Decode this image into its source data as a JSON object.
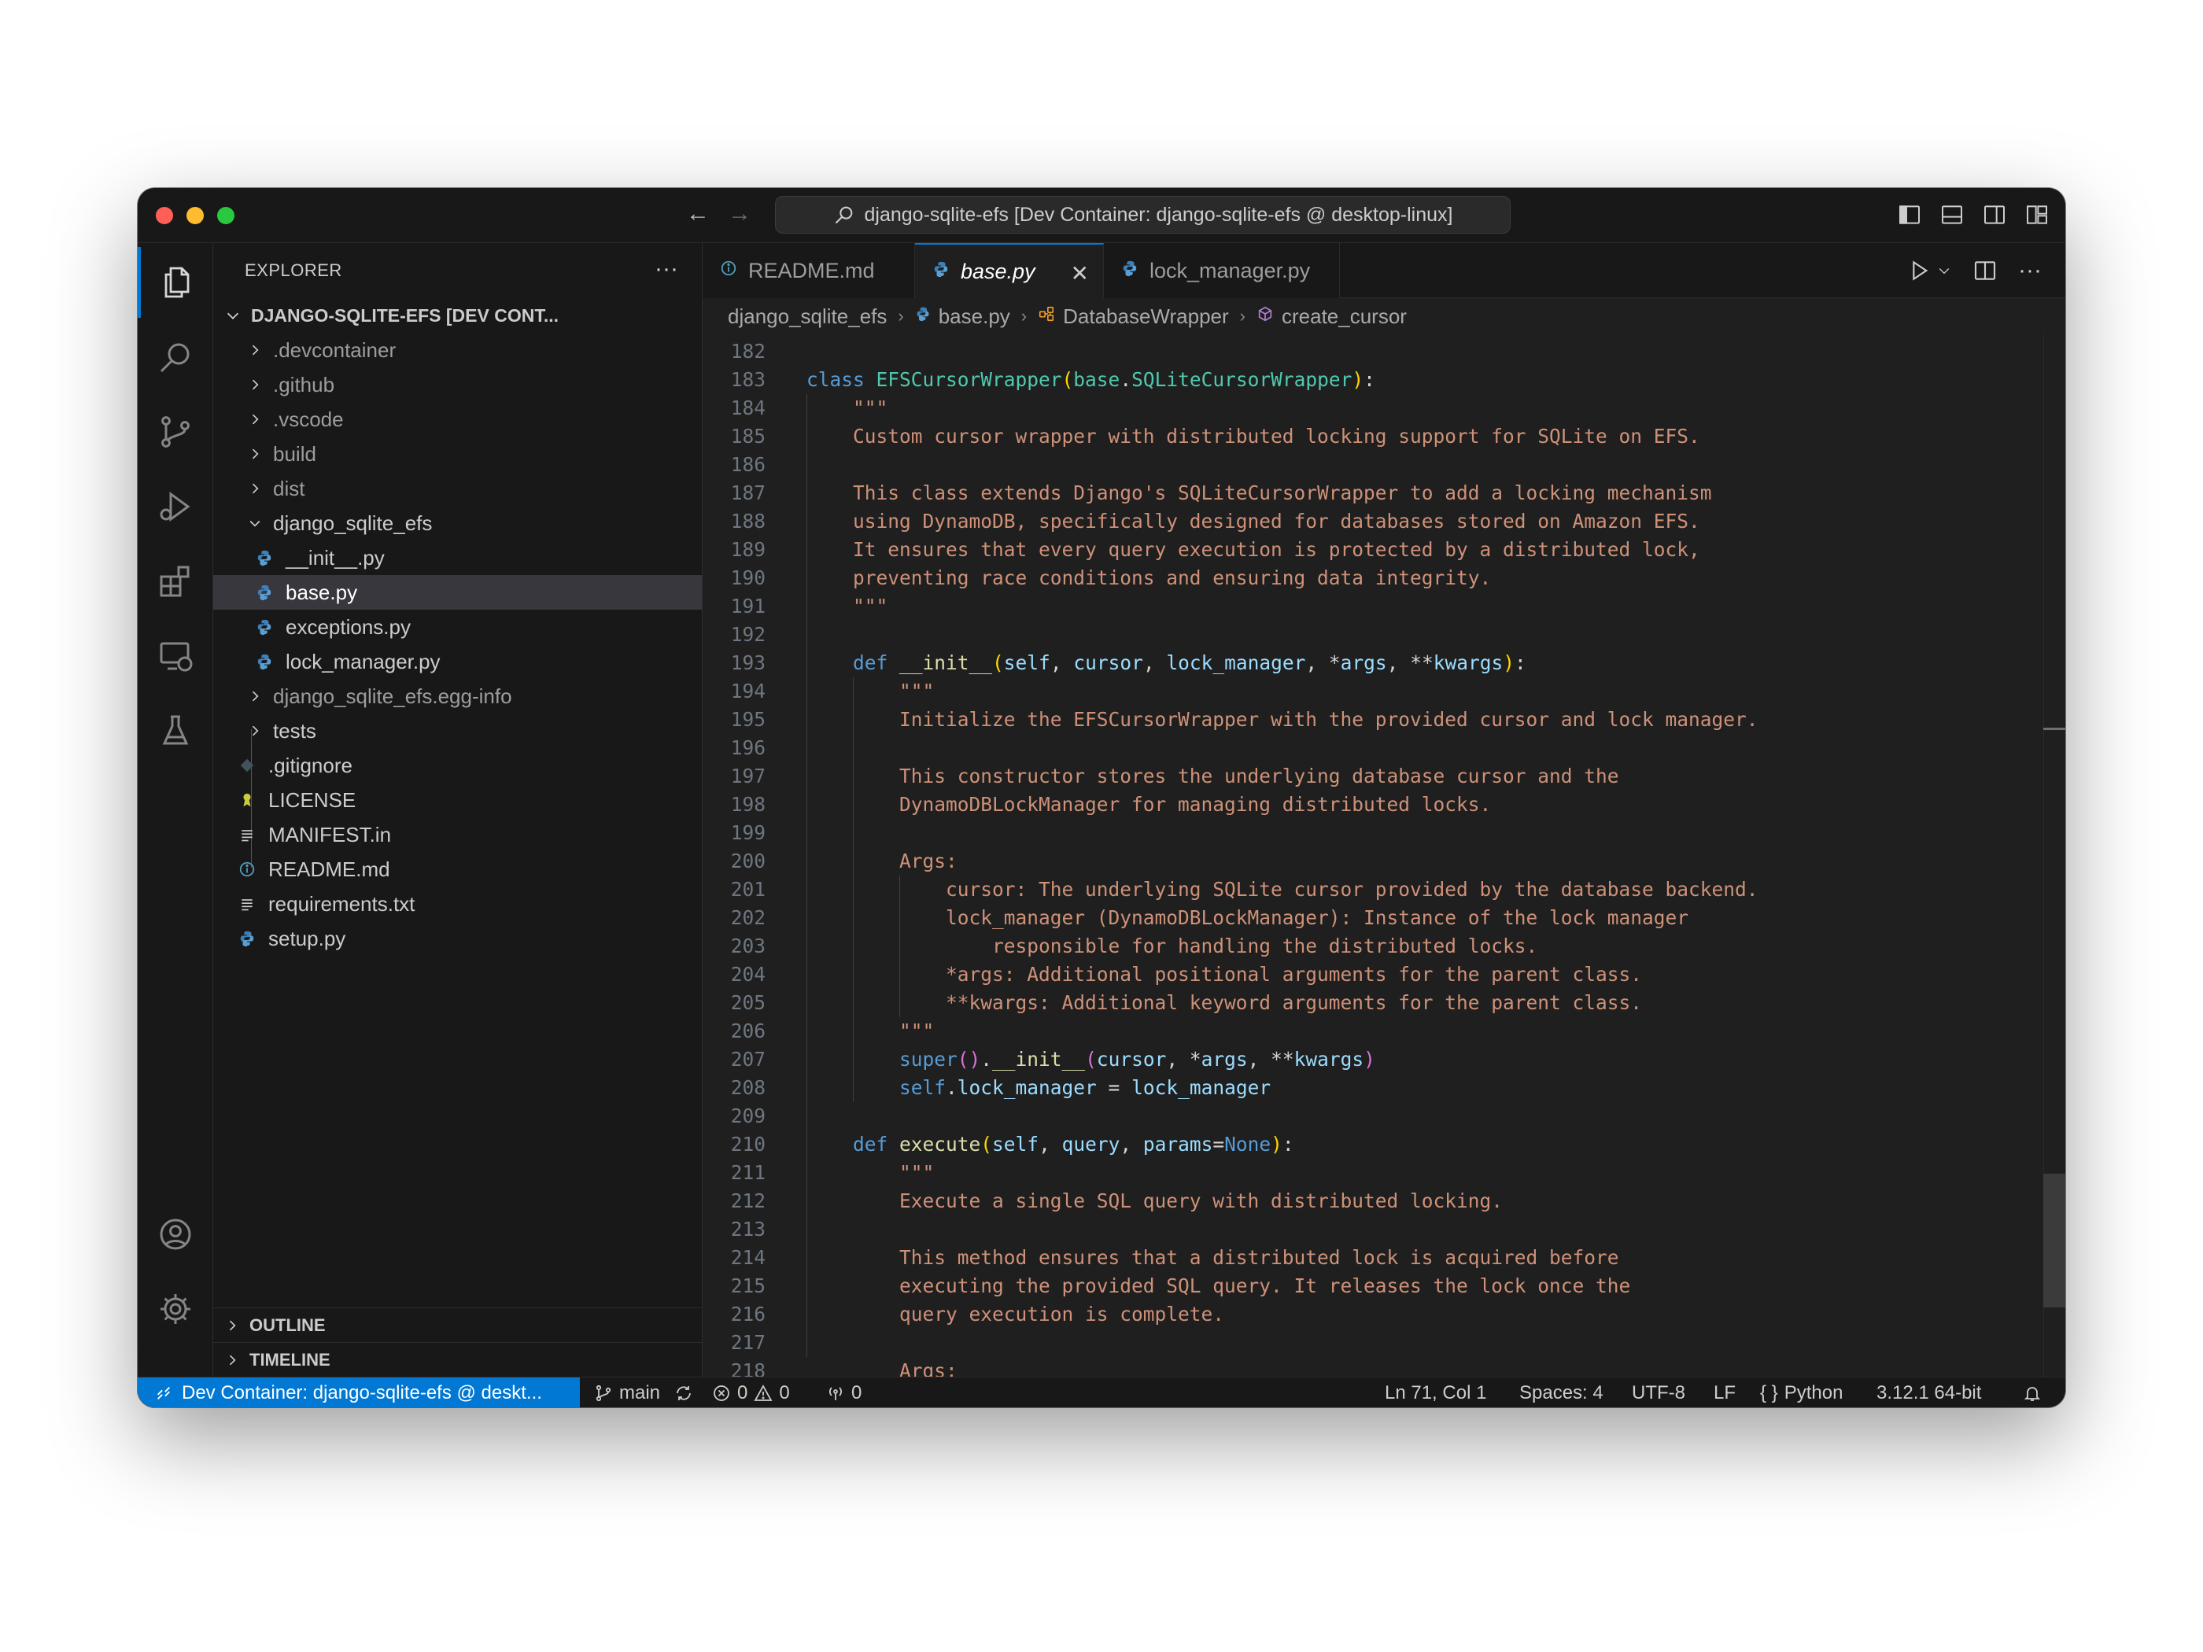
{
  "window": {
    "command_center": "django-sqlite-efs [Dev Container: django-sqlite-efs @ desktop-linux]"
  },
  "sidebar": {
    "title": "EXPLORER",
    "root": "DJANGO-SQLITE-EFS [DEV CONT...",
    "items": [
      {
        "label": ".devcontainer",
        "kind": "folder"
      },
      {
        "label": ".github",
        "kind": "folder"
      },
      {
        "label": ".vscode",
        "kind": "folder"
      },
      {
        "label": "build",
        "kind": "folder"
      },
      {
        "label": "dist",
        "kind": "folder"
      },
      {
        "label": "django_sqlite_efs",
        "kind": "folder-open"
      },
      {
        "label": "__init__.py",
        "kind": "python"
      },
      {
        "label": "base.py",
        "kind": "python"
      },
      {
        "label": "exceptions.py",
        "kind": "python"
      },
      {
        "label": "lock_manager.py",
        "kind": "python"
      },
      {
        "label": "django_sqlite_efs.egg-info",
        "kind": "folder"
      },
      {
        "label": "tests",
        "kind": "folder"
      },
      {
        "label": ".gitignore",
        "kind": "git"
      },
      {
        "label": "LICENSE",
        "kind": "license"
      },
      {
        "label": "MANIFEST.in",
        "kind": "lines"
      },
      {
        "label": "README.md",
        "kind": "info"
      },
      {
        "label": "requirements.txt",
        "kind": "lines"
      },
      {
        "label": "setup.py",
        "kind": "python"
      }
    ],
    "outline_label": "OUTLINE",
    "timeline_label": "TIMELINE"
  },
  "tabs": [
    {
      "label": "README.md",
      "icon": "info-icon"
    },
    {
      "label": "base.py",
      "icon": "python-icon",
      "active": true
    },
    {
      "label": "lock_manager.py",
      "icon": "python-icon"
    }
  ],
  "breadcrumbs": [
    "django_sqlite_efs",
    "base.py",
    "DatabaseWrapper",
    "create_cursor"
  ],
  "code_lines": [
    {
      "n": "182",
      "tokens": []
    },
    {
      "n": "183",
      "tokens": [
        [
          "kw",
          "class "
        ],
        [
          "cls",
          "EFSCursorWrapper"
        ],
        [
          "br1",
          "("
        ],
        [
          "cls",
          "base"
        ],
        [
          "pl",
          "."
        ],
        [
          "cls",
          "SQLiteCursorWrapper"
        ],
        [
          "br1",
          ")"
        ],
        [
          "pl",
          ":"
        ]
      ]
    },
    {
      "n": "184",
      "tokens": [
        [
          "str",
          "    \"\"\""
        ]
      ]
    },
    {
      "n": "185",
      "tokens": [
        [
          "str",
          "    Custom cursor wrapper with distributed locking support for SQLite on EFS."
        ]
      ]
    },
    {
      "n": "186",
      "tokens": []
    },
    {
      "n": "187",
      "tokens": [
        [
          "str",
          "    This class extends Django's SQLiteCursorWrapper to add a locking mechanism"
        ]
      ]
    },
    {
      "n": "188",
      "tokens": [
        [
          "str",
          "    using DynamoDB, specifically designed for databases stored on Amazon EFS."
        ]
      ]
    },
    {
      "n": "189",
      "tokens": [
        [
          "str",
          "    It ensures that every query execution is protected by a distributed lock,"
        ]
      ]
    },
    {
      "n": "190",
      "tokens": [
        [
          "str",
          "    preventing race conditions and ensuring data integrity."
        ]
      ]
    },
    {
      "n": "191",
      "tokens": [
        [
          "str",
          "    \"\"\""
        ]
      ]
    },
    {
      "n": "192",
      "tokens": []
    },
    {
      "n": "193",
      "tokens": [
        [
          "kw",
          "    def "
        ],
        [
          "fn",
          "__init__"
        ],
        [
          "br1",
          "("
        ],
        [
          "par",
          "self"
        ],
        [
          "pl",
          ", "
        ],
        [
          "par",
          "cursor"
        ],
        [
          "pl",
          ", "
        ],
        [
          "par",
          "lock_manager"
        ],
        [
          "pl",
          ", "
        ],
        [
          "pl",
          "*"
        ],
        [
          "par",
          "args"
        ],
        [
          "pl",
          ", "
        ],
        [
          "pl",
          "**"
        ],
        [
          "par",
          "kwargs"
        ],
        [
          "br1",
          ")"
        ],
        [
          "pl",
          ":"
        ]
      ]
    },
    {
      "n": "194",
      "tokens": [
        [
          "str",
          "        \"\"\""
        ]
      ]
    },
    {
      "n": "195",
      "tokens": [
        [
          "str",
          "        Initialize the EFSCursorWrapper with the provided cursor and lock manager."
        ]
      ]
    },
    {
      "n": "196",
      "tokens": []
    },
    {
      "n": "197",
      "tokens": [
        [
          "str",
          "        This constructor stores the underlying database cursor and the"
        ]
      ]
    },
    {
      "n": "198",
      "tokens": [
        [
          "str",
          "        DynamoDBLockManager for managing distributed locks."
        ]
      ]
    },
    {
      "n": "199",
      "tokens": []
    },
    {
      "n": "200",
      "tokens": [
        [
          "str",
          "        Args:"
        ]
      ]
    },
    {
      "n": "201",
      "tokens": [
        [
          "str",
          "            cursor: The underlying SQLite cursor provided by the database backend."
        ]
      ]
    },
    {
      "n": "202",
      "tokens": [
        [
          "str",
          "            lock_manager (DynamoDBLockManager): Instance of the lock manager"
        ]
      ]
    },
    {
      "n": "203",
      "tokens": [
        [
          "str",
          "                responsible for handling the distributed locks."
        ]
      ]
    },
    {
      "n": "204",
      "tokens": [
        [
          "str",
          "            *args: Additional positional arguments for the parent class."
        ]
      ]
    },
    {
      "n": "205",
      "tokens": [
        [
          "str",
          "            **kwargs: Additional keyword arguments for the parent class."
        ]
      ]
    },
    {
      "n": "206",
      "tokens": [
        [
          "str",
          "        \"\"\""
        ]
      ]
    },
    {
      "n": "207",
      "tokens": [
        [
          "kw",
          "        super"
        ],
        [
          "br2",
          "()"
        ],
        [
          "pl",
          "."
        ],
        [
          "fn",
          "__init__"
        ],
        [
          "br2",
          "("
        ],
        [
          "par",
          "cursor"
        ],
        [
          "pl",
          ", *"
        ],
        [
          "par",
          "args"
        ],
        [
          "pl",
          ", **"
        ],
        [
          "par",
          "kwargs"
        ],
        [
          "br2",
          ")"
        ]
      ]
    },
    {
      "n": "208",
      "tokens": [
        [
          "kw",
          "        self"
        ],
        [
          "pl",
          "."
        ],
        [
          "par",
          "lock_manager"
        ],
        [
          "pl",
          " = "
        ],
        [
          "par",
          "lock_manager"
        ]
      ]
    },
    {
      "n": "209",
      "tokens": []
    },
    {
      "n": "210",
      "tokens": [
        [
          "kw",
          "    def "
        ],
        [
          "fn",
          "execute"
        ],
        [
          "br1",
          "("
        ],
        [
          "par",
          "self"
        ],
        [
          "pl",
          ", "
        ],
        [
          "par",
          "query"
        ],
        [
          "pl",
          ", "
        ],
        [
          "par",
          "params"
        ],
        [
          "pl",
          "="
        ],
        [
          "kw",
          "None"
        ],
        [
          "br1",
          ")"
        ],
        [
          "pl",
          ":"
        ]
      ]
    },
    {
      "n": "211",
      "tokens": [
        [
          "str",
          "        \"\"\""
        ]
      ]
    },
    {
      "n": "212",
      "tokens": [
        [
          "str",
          "        Execute a single SQL query with distributed locking."
        ]
      ]
    },
    {
      "n": "213",
      "tokens": []
    },
    {
      "n": "214",
      "tokens": [
        [
          "str",
          "        This method ensures that a distributed lock is acquired before"
        ]
      ]
    },
    {
      "n": "215",
      "tokens": [
        [
          "str",
          "        executing the provided SQL query. It releases the lock once the"
        ]
      ]
    },
    {
      "n": "216",
      "tokens": [
        [
          "str",
          "        query execution is complete."
        ]
      ]
    },
    {
      "n": "217",
      "tokens": []
    },
    {
      "n": "218",
      "tokens": [
        [
          "str",
          "        Args:"
        ]
      ]
    }
  ],
  "statusbar": {
    "remote": "Dev Container: django-sqlite-efs @ deskt...",
    "branch": "main",
    "errors": "0",
    "warnings": "0",
    "ports": "0",
    "position": "Ln 71, Col 1",
    "spaces": "Spaces: 4",
    "encoding": "UTF-8",
    "eol": "LF",
    "language": "Python",
    "interpreter": "3.12.1 64-bit"
  },
  "colors": {
    "accent": "#0078d4",
    "keyword": "#569cd6",
    "class": "#4ec9b0",
    "string": "#ce9178",
    "function": "#dcdcaa",
    "parameter": "#9cdcfe"
  }
}
